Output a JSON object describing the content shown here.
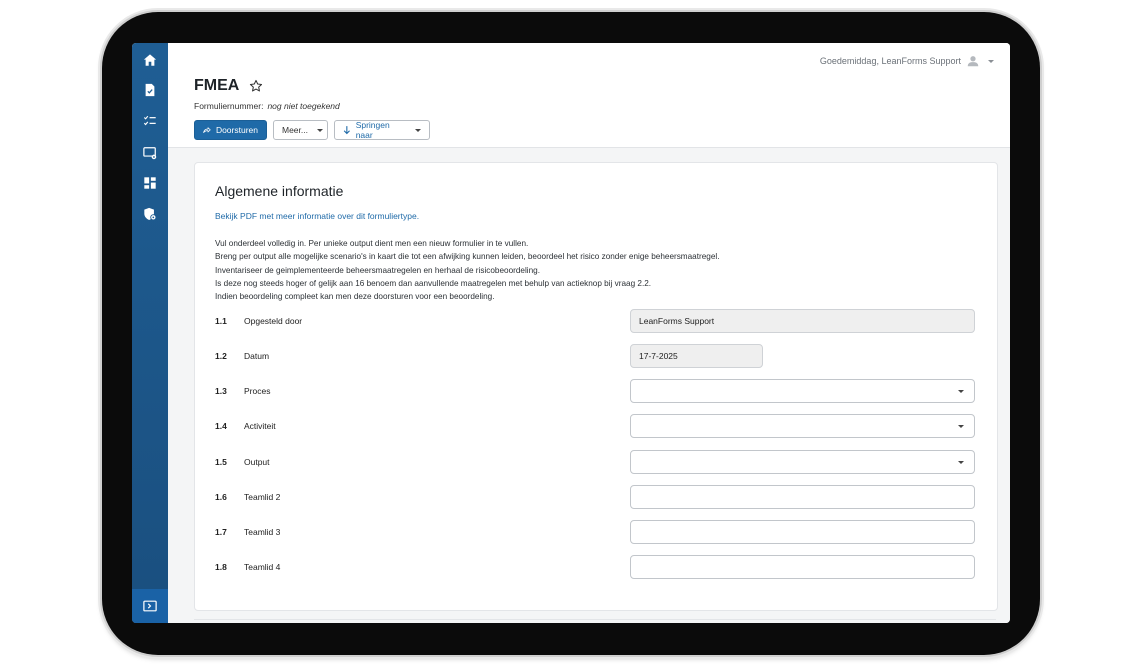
{
  "app": {
    "greeting": "Goedemiddag, LeanForms Support"
  },
  "page": {
    "title": "FMEA",
    "form_number_label": "Formuliernummer:",
    "form_number_value": "nog niet toegekend"
  },
  "toolbar": {
    "forward_label": "Doorsturen",
    "more_label": "Meer...",
    "jump_label": "Springen naar"
  },
  "sidebar": {
    "items": [
      {
        "icon": "home-icon"
      },
      {
        "icon": "document-icon"
      },
      {
        "icon": "checklist-icon"
      },
      {
        "icon": "screen-settings-icon"
      },
      {
        "icon": "dashboard-icon"
      },
      {
        "icon": "shield-settings-icon"
      }
    ],
    "bottom_icon": "expand-sidebar-icon"
  },
  "section": {
    "title": "Algemene informatie",
    "pdf_link": "Bekijk PDF met meer informatie over dit formuliertype.",
    "instructions": [
      "Vul onderdeel volledig in. Per unieke output dient men een nieuw formulier in te vullen.",
      "Breng per output alle mogelijke scenario's in kaart die tot een afwijking kunnen leiden, beoordeel het risico zonder enige beheersmaatregel.",
      "Inventariseer de geimplementeerde beheersmaatregelen en herhaal de risicobeoordeling.",
      "Is deze nog steeds hoger of gelijk aan 16 benoem dan aanvullende maatregelen met behulp van actieknop bij vraag 2.2.",
      "Indien beoordeling compleet kan men deze doorsturen voor een beoordeling."
    ]
  },
  "fields": [
    {
      "num": "1.1",
      "label": "Opgesteld door",
      "value": "LeanForms Support",
      "type": "readonly"
    },
    {
      "num": "1.2",
      "label": "Datum",
      "value": "17-7-2025",
      "type": "readonly-short"
    },
    {
      "num": "1.3",
      "label": "Proces",
      "value": "",
      "type": "select"
    },
    {
      "num": "1.4",
      "label": "Activiteit",
      "value": "",
      "type": "select"
    },
    {
      "num": "1.5",
      "label": "Output",
      "value": "",
      "type": "select"
    },
    {
      "num": "1.6",
      "label": "Teamlid 2",
      "value": "",
      "type": "text"
    },
    {
      "num": "1.7",
      "label": "Teamlid 3",
      "value": "",
      "type": "text"
    },
    {
      "num": "1.8",
      "label": "Teamlid 4",
      "value": "",
      "type": "text"
    }
  ],
  "colors": {
    "primary": "#1f6aa8",
    "sidebar": "#1f5e94",
    "link": "#1f6aa8"
  }
}
